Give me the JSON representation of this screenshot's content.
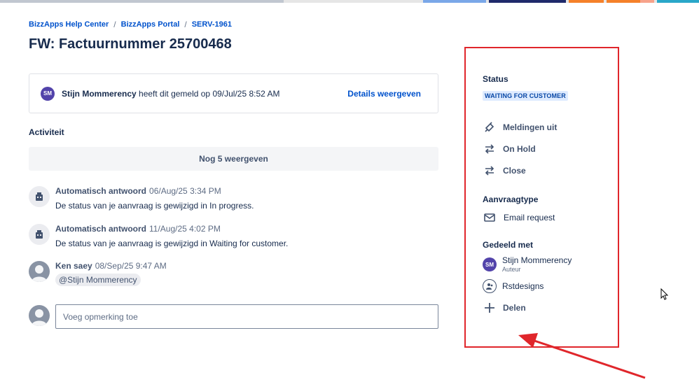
{
  "colors": {
    "accent": "#0052cc",
    "annotation_red": "#e0262b",
    "status_bg": "#deebff",
    "status_text": "#0747a6"
  },
  "breadcrumb": [
    "BizzApps Help Center",
    "BizzApps Portal",
    "SERV-1961"
  ],
  "page_title": "FW: Factuurnummer 25700468",
  "reporter": {
    "initials": "SM",
    "name": "Stijn Mommerency",
    "text": " heeft dit gemeld op 09/Jul/25 8:52 AM",
    "details_link": "Details weergeven"
  },
  "activity_label": "Activiteit",
  "show_more": "Nog 5 weergeven",
  "activities": [
    {
      "author": "Automatisch antwoord",
      "time": "06/Aug/25 3:34 PM",
      "message": "De status van je aanvraag is gewijzigd in In progress.",
      "avatar": "bot-icon"
    },
    {
      "author": "Automatisch antwoord",
      "time": "11/Aug/25 4:02 PM",
      "message": "De status van je aanvraag is gewijzigd in Waiting for customer.",
      "avatar": "bot-icon"
    },
    {
      "author": "Ken saey",
      "time": "08/Sep/25 9:47 AM",
      "mention": "@Stijn Mommerency",
      "avatar": "user-icon"
    }
  ],
  "comment_placeholder": "Voeg opmerking toe",
  "sidebar": {
    "status_heading": "Status",
    "status_value": "WAITING FOR CUSTOMER",
    "actions": [
      {
        "label": "Meldingen uit",
        "icon": "notification-off-icon"
      },
      {
        "label": "On Hold",
        "icon": "transition-icon"
      },
      {
        "label": "Close",
        "icon": "transition-icon"
      }
    ],
    "request_type_heading": "Aanvraagtype",
    "request_type": "Email request",
    "shared_heading": "Gedeeld met",
    "shared": [
      {
        "initials": "SM",
        "name": "Stijn Mommerency",
        "role": "Auteur"
      },
      {
        "name": "Rstdesigns"
      }
    ],
    "share_label": "Delen"
  }
}
